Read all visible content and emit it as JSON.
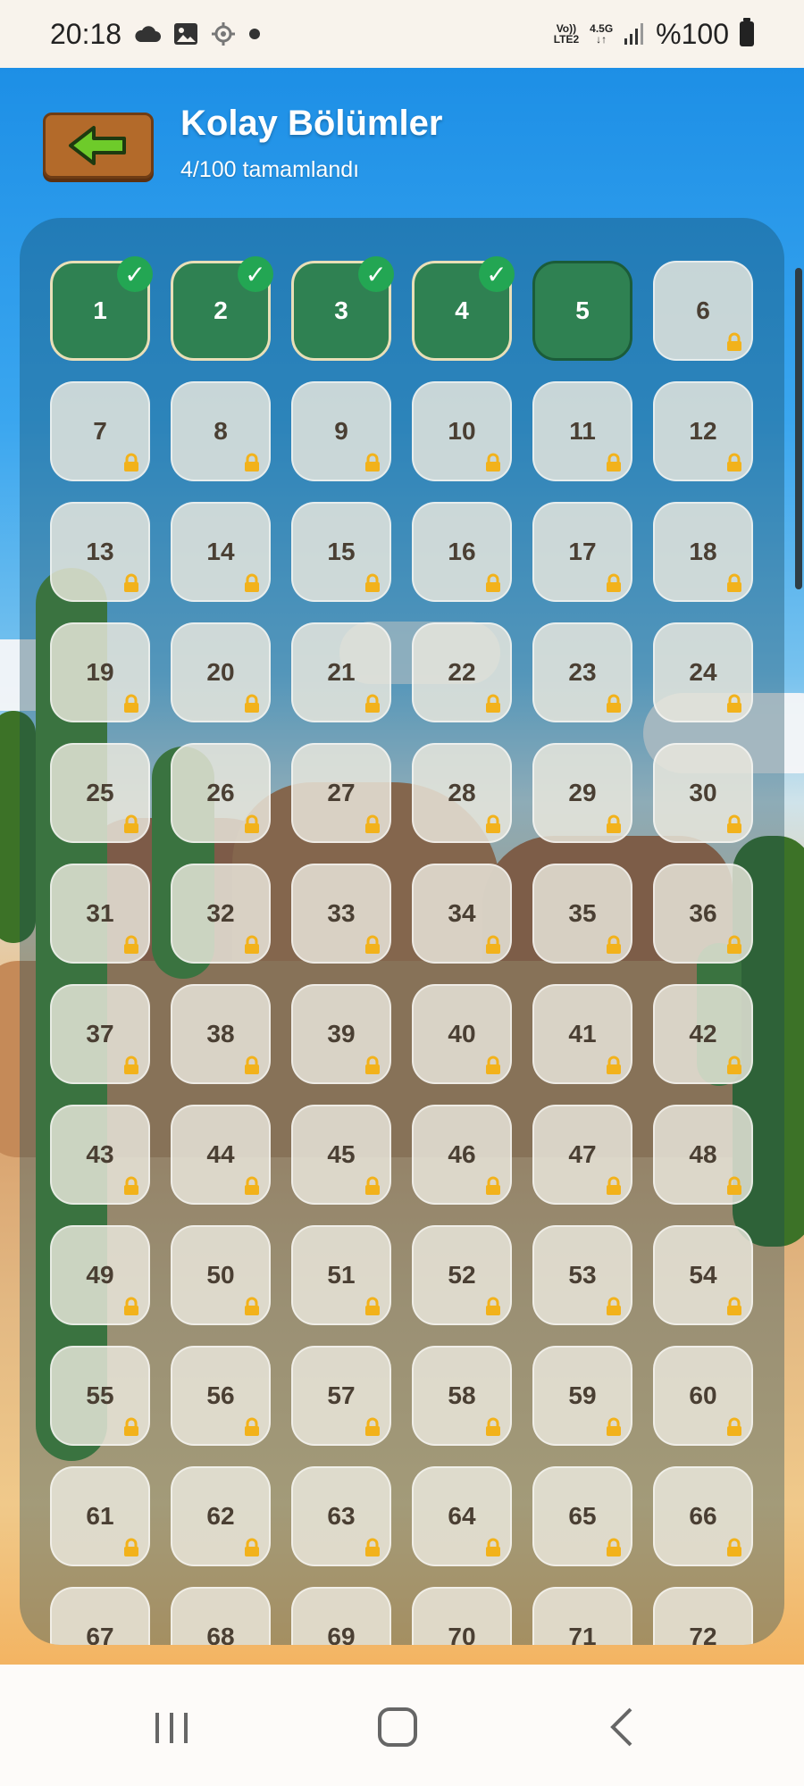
{
  "status_bar": {
    "time": "20:18",
    "network_top": "Vo))",
    "network_bottom": "LTE2",
    "signal_type": "4.5G",
    "battery": "%100",
    "left_icons": [
      "cloud-icon",
      "image-icon",
      "location-icon",
      "dot-icon"
    ]
  },
  "header": {
    "title": "Kolay Bölümler",
    "subtitle": "4/100 tamamlandı",
    "back_icon": "arrow-left-icon"
  },
  "levels": {
    "completed": [
      "1",
      "2",
      "3",
      "4"
    ],
    "current": "5",
    "visible_locked_start": 6,
    "visible_last": 72
  },
  "colors": {
    "completed": "#2f8152",
    "check": "#23a653",
    "locked": "#ece9de",
    "lock_icon": "#f2b21b"
  },
  "nav": {
    "items": [
      "recent-apps-icon",
      "home-icon",
      "back-icon"
    ]
  }
}
